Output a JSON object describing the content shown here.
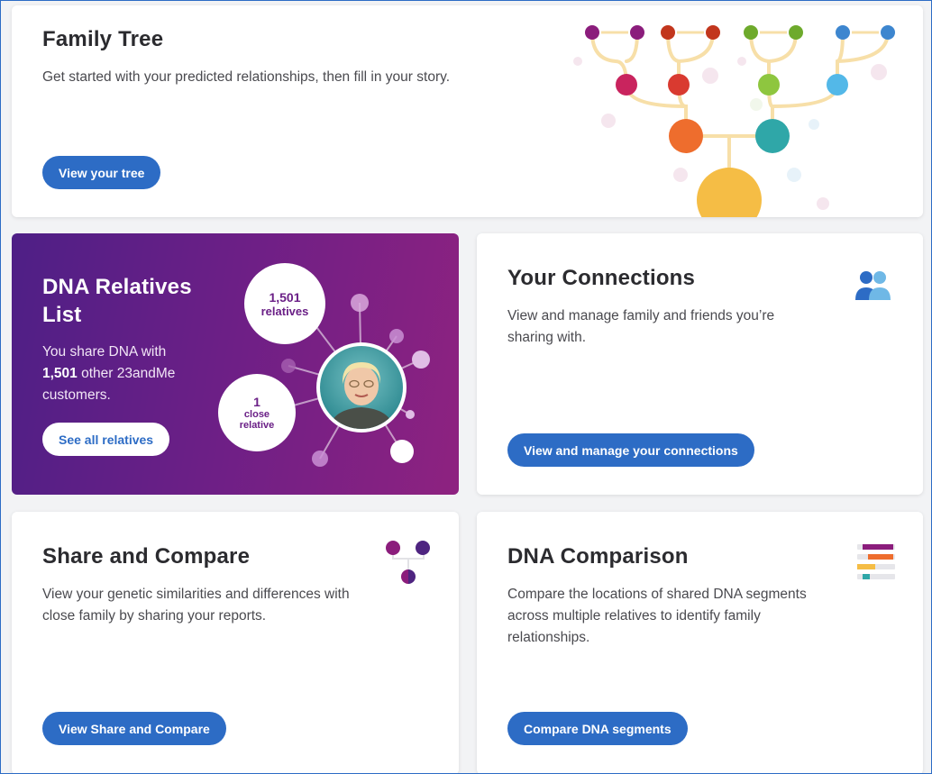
{
  "family_tree": {
    "title": "Family Tree",
    "description": "Get started with your predicted relationships, then fill in your story.",
    "button": "View your tree"
  },
  "dna_relatives": {
    "title_line1": "DNA Relatives",
    "title_line2": "List",
    "desc_prefix": "You share DNA with",
    "count": "1,501",
    "desc_suffix": "other 23andMe",
    "desc_line3": "customers.",
    "button": "See all relatives",
    "bubble_relatives_count": "1,501",
    "bubble_relatives_label": "relatives",
    "bubble_close_count": "1",
    "bubble_close_label_1": "close",
    "bubble_close_label_2": "relative"
  },
  "connections": {
    "title": "Your Connections",
    "description": "View and manage family and friends you’re sharing with.",
    "button": "View and manage your connections",
    "icon": "people-icon"
  },
  "share_compare": {
    "title": "Share and Compare",
    "description": "View your genetic similarities and differences with close family by sharing your reports.",
    "button": "View Share and Compare",
    "icon": "share-compare-icon"
  },
  "dna_comparison": {
    "title": "DNA Comparison",
    "description": "Compare the locations of shared DNA segments across multiple relatives to identify family relationships.",
    "button": "Compare DNA segments",
    "icon": "dna-segments-icon"
  },
  "colors": {
    "accent": "#2d6cc5",
    "purple_start": "#4e1f86",
    "purple_end": "#8e2280"
  }
}
